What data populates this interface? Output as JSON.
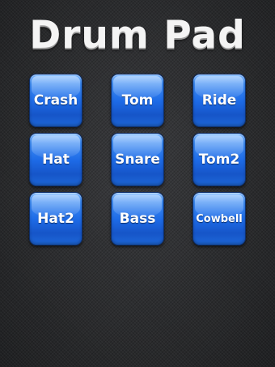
{
  "app": {
    "title": "Drum Pad"
  },
  "colors": {
    "background": "#2b2c2e",
    "pad_blue": "#1d6ae6",
    "pad_border": "#0e2f6a",
    "title_text": "#f4f4f4"
  },
  "pads": [
    {
      "label": "Crash"
    },
    {
      "label": "Tom"
    },
    {
      "label": "Ride"
    },
    {
      "label": "Hat"
    },
    {
      "label": "Snare"
    },
    {
      "label": "Tom2"
    },
    {
      "label": "Hat2"
    },
    {
      "label": "Bass"
    },
    {
      "label": "Cowbell"
    }
  ]
}
